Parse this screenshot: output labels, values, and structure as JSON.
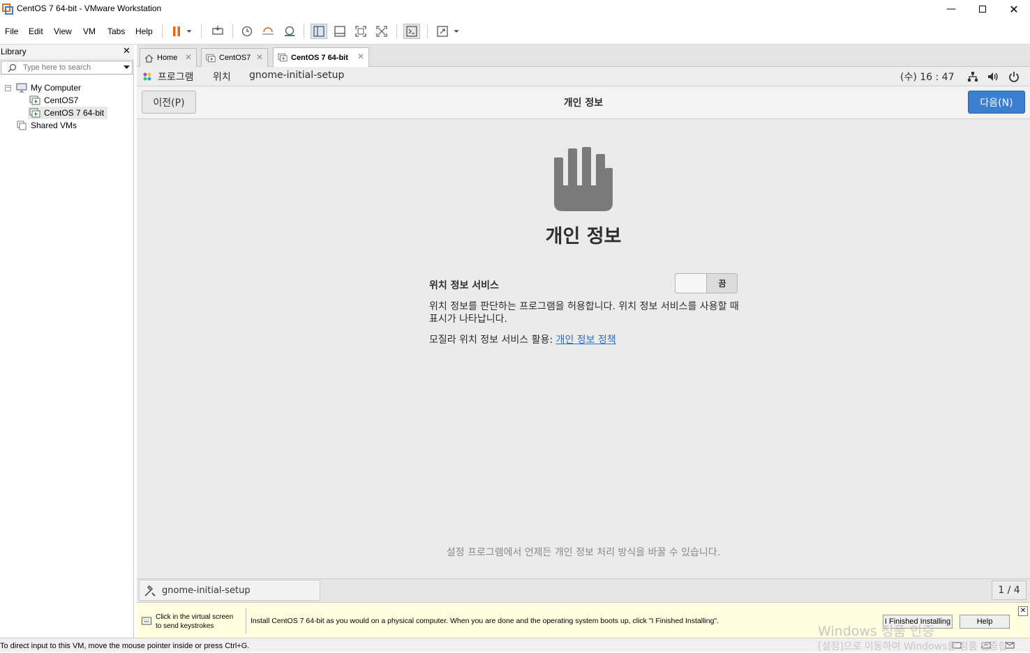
{
  "window": {
    "title": "CentOS 7 64-bit - VMware Workstation"
  },
  "menu": [
    "File",
    "Edit",
    "View",
    "VM",
    "Tabs",
    "Help"
  ],
  "library": {
    "title": "Library",
    "search_placeholder": "Type here to search",
    "tree": [
      "My Computer",
      "CentOS7",
      "CentOS 7 64-bit",
      "Shared VMs"
    ]
  },
  "tabs": [
    {
      "label": "Home",
      "icon": "home-icon"
    },
    {
      "label": "CentOS7",
      "icon": "vm-icon"
    },
    {
      "label": "CentOS 7 64-bit",
      "icon": "vm-icon",
      "active": true
    }
  ],
  "gnome": {
    "topbar": {
      "apps": "프로그램",
      "places": "위치",
      "app_name": "gnome-initial-setup",
      "clock": "(수) 16 : 47"
    },
    "header": {
      "back": "이전(P)",
      "title": "개인 정보",
      "next": "다음(N)"
    },
    "page": {
      "heading": "개인 정보",
      "location_label": "위치 정보 서비스",
      "toggle_state": "끔",
      "description": "위치 정보를 판단하는 프로그램을 허용합니다. 위치 정보 서비스를 사용할 때 표시가 나타납니다.",
      "mozilla_text": "모질라 위치 정보 서비스 활용:",
      "privacy_link": "개인 정보 정책",
      "footer_note": "설정 프로그램에서 언제든 개인 정보 처리 방식을 바꿀 수 있습니다."
    },
    "taskbar": {
      "app": "gnome-initial-setup",
      "pager": "1 / 4"
    }
  },
  "hint": {
    "click_text_1": "Click in the virtual screen",
    "click_text_2": "to send keystrokes",
    "message": "Install CentOS 7 64-bit as you would on a physical computer. When you are done and the operating system boots up, click \"I Finished Installing\".",
    "finished_button": "I Finished Installing",
    "help_button": "Help"
  },
  "watermark": {
    "line1": "Windows 정품 인증",
    "line2": "[설정]으로 이동하여 Windows를 정품 인증합"
  },
  "status": "To direct input to this VM, move the mouse pointer inside or press Ctrl+G.",
  "colors": {
    "accent": "#3a7fd0",
    "link": "#2a6fc9",
    "pause": "#e06a1a"
  }
}
